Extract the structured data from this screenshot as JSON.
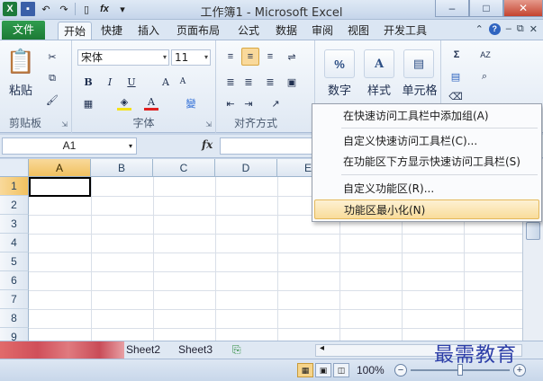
{
  "window": {
    "title": "工作簿1 - Microsoft Excel"
  },
  "tabs": [
    "文件",
    "开始",
    "快捷",
    "插入",
    "页面布局",
    "公式",
    "数据",
    "审阅",
    "视图",
    "开发工具"
  ],
  "clipboard": {
    "paste_label": "粘贴",
    "group_label": "剪贴板"
  },
  "font": {
    "name": "宋体",
    "size": "11",
    "bold": "B",
    "italic": "I",
    "underline": "U",
    "grow": "A",
    "shrink": "A",
    "wen": "變",
    "group_label": "字体"
  },
  "alignment": {
    "group_label": "对齐方式"
  },
  "number": {
    "label": "数字",
    "percent": "%"
  },
  "styles": {
    "label": "样式"
  },
  "cells": {
    "label": "单元格"
  },
  "editing": {
    "sum": "Σ",
    "sort": "AZ"
  },
  "formula_bar": {
    "name_box": "A1",
    "fx": "fx",
    "value": ""
  },
  "columns": [
    "A",
    "B",
    "C",
    "D",
    "E"
  ],
  "rows": [
    "1",
    "2",
    "3",
    "4",
    "5",
    "6",
    "7",
    "8",
    "9"
  ],
  "sheets": [
    "Sheet2",
    "Sheet3"
  ],
  "status": {
    "zoom": "100%"
  },
  "context_menu": {
    "items": [
      "在快速访问工具栏中添加组(A)",
      "自定义快速访问工具栏(C)...",
      "在功能区下方显示快速访问工具栏(S)",
      "自定义功能区(R)...",
      "功能区最小化(N)"
    ],
    "highlighted_index": 4
  },
  "watermark": "最需教育",
  "colors": {
    "file_tab": "#1c7a35",
    "selection_header": "#f1c15f",
    "menu_highlight": "#f9dc9a"
  }
}
